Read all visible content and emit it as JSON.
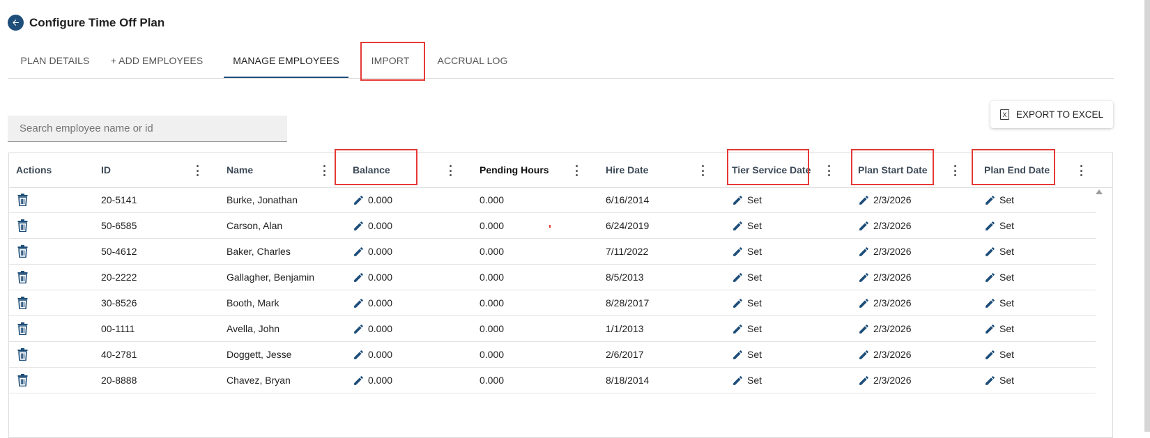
{
  "header": {
    "title": "Configure Time Off Plan"
  },
  "tabs": [
    {
      "label": "PLAN DETAILS",
      "active": false
    },
    {
      "label": "+ ADD EMPLOYEES",
      "active": false
    },
    {
      "label": "MANAGE EMPLOYEES",
      "active": true
    },
    {
      "label": "IMPORT",
      "active": false
    },
    {
      "label": "ACCRUAL LOG",
      "active": false
    }
  ],
  "search": {
    "placeholder": "Search employee name or id",
    "value": ""
  },
  "export": {
    "label": "EXPORT TO EXCEL",
    "icon": "excel-file-icon"
  },
  "columns": {
    "actions": "Actions",
    "id": "ID",
    "name": "Name",
    "balance": "Balance",
    "pending": "Pending Hours",
    "hire": "Hire Date",
    "tier": "Tier Service Date",
    "plan_start": "Plan Start Date",
    "plan_end": "Plan End Date"
  },
  "rows": [
    {
      "id": "20-5141",
      "name": "Burke, Jonathan",
      "balance": "0.000",
      "pending": "0.000",
      "hire": "6/16/2014",
      "tier": "Set",
      "plan_start": "2/3/2026",
      "plan_end": "Set"
    },
    {
      "id": "50-6585",
      "name": "Carson, Alan",
      "balance": "0.000",
      "pending": "0.000",
      "hire": "6/24/2019",
      "tier": "Set",
      "plan_start": "2/3/2026",
      "plan_end": "Set"
    },
    {
      "id": "50-4612",
      "name": "Baker, Charles",
      "balance": "0.000",
      "pending": "0.000",
      "hire": "7/11/2022",
      "tier": "Set",
      "plan_start": "2/3/2026",
      "plan_end": "Set"
    },
    {
      "id": "20-2222",
      "name": "Gallagher, Benjamin",
      "balance": "0.000",
      "pending": "0.000",
      "hire": "8/5/2013",
      "tier": "Set",
      "plan_start": "2/3/2026",
      "plan_end": "Set"
    },
    {
      "id": "30-8526",
      "name": "Booth, Mark",
      "balance": "0.000",
      "pending": "0.000",
      "hire": "8/28/2017",
      "tier": "Set",
      "plan_start": "2/3/2026",
      "plan_end": "Set"
    },
    {
      "id": "00-1111",
      "name": "Avella, John",
      "balance": "0.000",
      "pending": "0.000",
      "hire": "1/1/2013",
      "tier": "Set",
      "plan_start": "2/3/2026",
      "plan_end": "Set"
    },
    {
      "id": "40-2781",
      "name": "Doggett, Jesse",
      "balance": "0.000",
      "pending": "0.000",
      "hire": "2/6/2017",
      "tier": "Set",
      "plan_start": "2/3/2026",
      "plan_end": "Set"
    },
    {
      "id": "20-8888",
      "name": "Chavez, Bryan",
      "balance": "0.000",
      "pending": "0.000",
      "hire": "8/18/2014",
      "tier": "Set",
      "plan_start": "2/3/2026",
      "plan_end": "Set"
    }
  ],
  "colors": {
    "accent": "#1e4e79",
    "highlight": "#e53935"
  }
}
